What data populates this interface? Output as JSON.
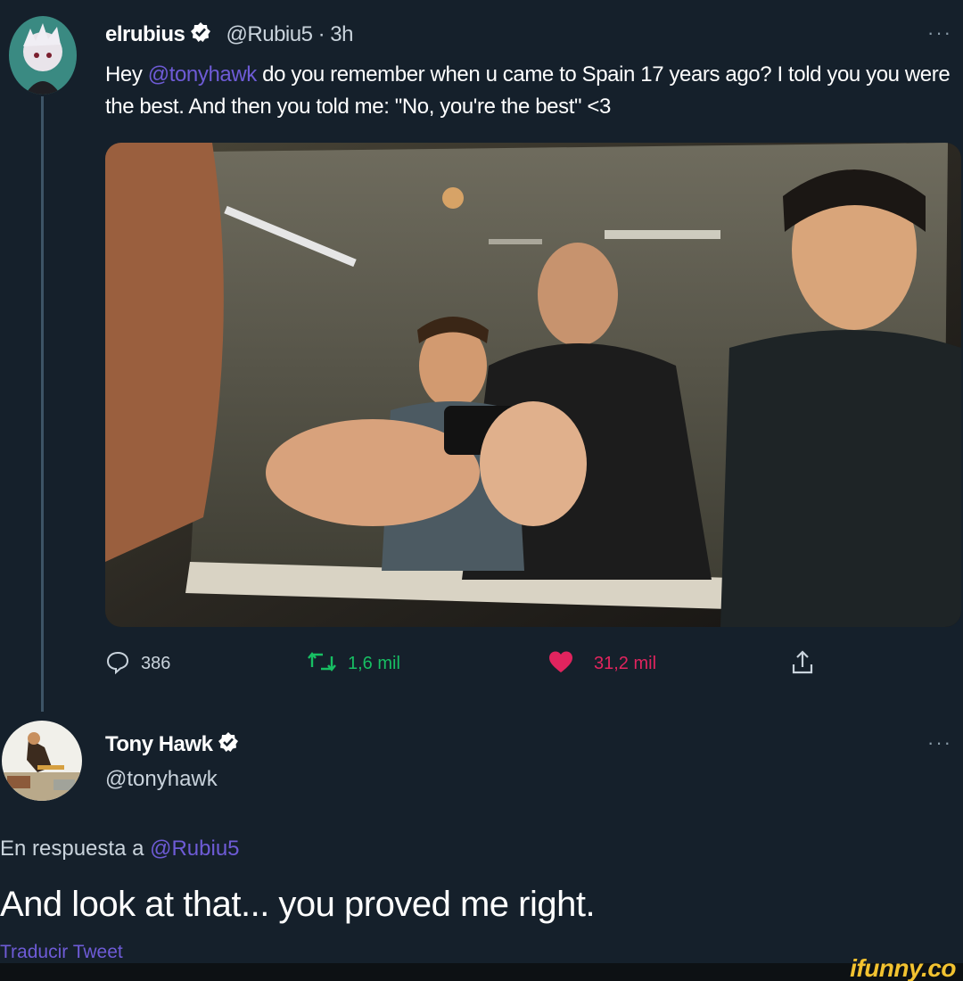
{
  "tweet1": {
    "author_name": "elrubius",
    "handle_time": "@Rubiu5 · 3h",
    "text_before": "Hey ",
    "mention": "@tonyhawk",
    "text_after": " do you remember when u came to Spain 17 years ago? I told you you were the best. And then you told me: \"No, you're the best\" <3",
    "more": "···",
    "actions": {
      "reply_count": "386",
      "retweet_count": "1,6 mil",
      "like_count": "31,2 mil"
    }
  },
  "tweet2": {
    "author_name": "Tony Hawk",
    "handle": "@tonyhawk",
    "more": "···",
    "reply_prefix": "En respuesta a ",
    "reply_mention": "@Rubiu5",
    "text": "And look at that... you proved me right.",
    "translate": "Traducir Tweet"
  },
  "watermark": "ifunny.co",
  "colors": {
    "background": "#15202b",
    "mention": "#6e5bd6",
    "retweet": "#17bf63",
    "like": "#e0245e",
    "verified": "#ffffff"
  },
  "icons": [
    "reply-icon",
    "retweet-icon",
    "heart-icon",
    "share-icon",
    "verified-badge-icon",
    "more-icon"
  ]
}
